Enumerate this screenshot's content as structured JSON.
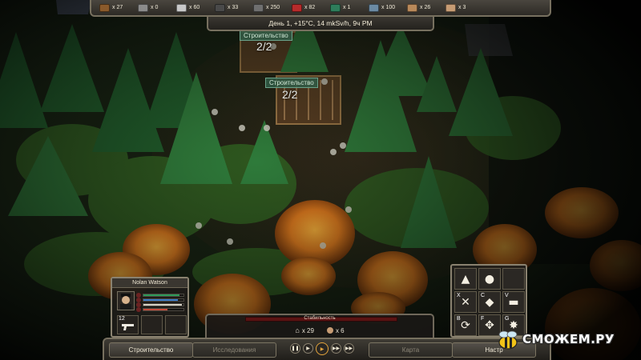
{
  "resources": [
    {
      "name": "wood",
      "count": "x 27",
      "color": "#8a5a2b"
    },
    {
      "name": "stone",
      "count": "x 0",
      "color": "#8b8b8b"
    },
    {
      "name": "metal",
      "count": "x 60",
      "color": "#c9c9c9"
    },
    {
      "name": "scrap",
      "count": "x 33",
      "color": "#4a4a4a"
    },
    {
      "name": "parts",
      "count": "x 250",
      "color": "#6f6f6f"
    },
    {
      "name": "fuel",
      "count": "x 82",
      "color": "#b72b2b"
    },
    {
      "name": "medicine",
      "count": "x 1",
      "color": "#2e7d5b"
    },
    {
      "name": "components",
      "count": "x 100",
      "color": "#6b8aa3"
    },
    {
      "name": "survivors",
      "count": "x 26",
      "color": "#b9895a"
    },
    {
      "name": "colonists",
      "count": "x 3",
      "color": "#c79c74"
    }
  ],
  "status": "День 1, +15°C, 14 mkSv/h, 9ч PM",
  "world": {
    "site1": {
      "label": "Строительство",
      "count": "2/2"
    },
    "site2": {
      "label": "Строительство",
      "count": "2/2"
    }
  },
  "character": {
    "name": "Nolan Watson",
    "badge": "12",
    "bars": [
      {
        "name": "health",
        "value": 0.9,
        "color": "#2e9a59"
      },
      {
        "name": "energy",
        "value": 0.85,
        "color": "#3a7bc8"
      },
      {
        "name": "food",
        "value": 0.95,
        "color": "#d6d2c6"
      },
      {
        "name": "water",
        "value": 0.6,
        "color": "#c44b3b"
      }
    ]
  },
  "actions": [
    {
      "key": "",
      "icon": "palisade-icon",
      "glyph": "▲"
    },
    {
      "key": "",
      "icon": "grenade-icon",
      "glyph": "●"
    },
    {
      "key": "",
      "icon": "empty-slot",
      "glyph": ""
    },
    {
      "key": "X",
      "icon": "attack-icon",
      "glyph": "✕"
    },
    {
      "key": "C",
      "icon": "crouch-icon",
      "glyph": "◆"
    },
    {
      "key": "V",
      "icon": "gun-icon",
      "glyph": "▬"
    },
    {
      "key": "B",
      "icon": "cycle-icon",
      "glyph": "⟳"
    },
    {
      "key": "F",
      "icon": "move-icon",
      "glyph": "✥"
    },
    {
      "key": "G",
      "icon": "scatter-icon",
      "glyph": "✸"
    }
  ],
  "stability": {
    "label": "Стабильность",
    "value": 0.0,
    "houses": "x 29",
    "people": "x 6"
  },
  "bottom": {
    "build": "Строительство",
    "research": "Исследования",
    "map": "Карта",
    "settings": "Настр"
  },
  "speed": [
    {
      "name": "pause",
      "glyph": "❚❚"
    },
    {
      "name": "slow",
      "glyph": "▶"
    },
    {
      "name": "normal",
      "glyph": "▶"
    },
    {
      "name": "fast",
      "glyph": "▶▶"
    },
    {
      "name": "fastest",
      "glyph": "▶▶"
    }
  ],
  "watermark": "СМОЖЕМ.РУ"
}
